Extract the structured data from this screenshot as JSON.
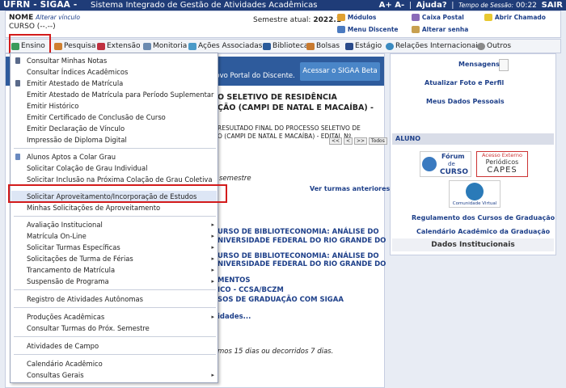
{
  "topbar": {
    "brand": "UFRN - SIGAA -",
    "subtitle": "Sistema Integrado de Gestão de Atividades Acadêmicas",
    "font_controls": "A+ A-",
    "help": "Ajuda?",
    "session_label": "Tempo de Sessão:",
    "session_time": "00:22",
    "logout": "SAIR"
  },
  "infobar": {
    "name_label": "NOME",
    "name_link": "Alterar vínculo",
    "course": "CURSO (--.--)",
    "semester_label": "Semestre atual:",
    "semester_value": "2022.1",
    "modulos": "Módulos",
    "caixa_postal": "Caixa Postal",
    "abrir_chamado": "Abrir Chamado",
    "menu_discente": "Menu Discente",
    "alterar_senha": "Alterar senha"
  },
  "menubar": {
    "items": [
      "Ensino",
      "Pesquisa",
      "Extensão",
      "Monitoria",
      "Ações Associadas",
      "Biblioteca",
      "Bolsas",
      "Estágio",
      "Relações Internacionais",
      "Outros"
    ]
  },
  "dropdown": {
    "group1": [
      "Consultar Minhas Notas",
      "Consultar Índices Acadêmicos",
      "Emitir Atestado de Matrícula",
      "Emitir Atestado de Matrícula para Período Suplementar",
      "Emitir Histórico",
      "Emitir Certificado de Conclusão de Curso",
      "Emitir Declaração de Vínculo",
      "Impressão de Diploma Digital"
    ],
    "group2": [
      "Alunos Aptos a Colar Grau",
      "Solicitar Colação de Grau Individual",
      "Solicitar Inclusão na Próxima Colação de Grau Coletiva",
      "Solicitar Aproveitamento/Incorporação de Estudos",
      "Minhas Solicitações de Aproveitamento"
    ],
    "group3": [
      "Avaliação Institucional",
      "Matrícula On-Line",
      "Solicitar Turmas Específicas",
      "Solicitações de Turma de Férias",
      "Trancamento de Matrícula",
      "Suspensão de Programa"
    ],
    "group4": [
      "Registro de Atividades Autônomas"
    ],
    "group5": [
      "Produções Acadêmicas",
      "Consultar Turmas do Próx. Semestre"
    ],
    "group6": [
      "Atividades de Campo"
    ],
    "group7": [
      "Calendário Acadêmico",
      "Consultas Gerais"
    ]
  },
  "main": {
    "portal_text": "novo Portal do Discente.",
    "portal_button": "Acessar o SIGAA Beta",
    "news_title_1": "O SELETIVO DE RESIDÊNCIA",
    "news_title_2": "ÇÃO (CAMPI DE NATAL E MACAÍBA) -",
    "news_body_1": "RESULTADO FINAL DO  PROCESSO SELETIVO DE",
    "news_body_2": "O (CAMPI DE NATAL E MACAÍBA) - EDITAL Nº",
    "pager": [
      "<<",
      "<",
      ">>",
      "Todos"
    ],
    "semestre_text": "semestre",
    "ver_turmas": "Ver turmas anteriores",
    "curso_1a": "URSO DE BIBLIOTECONOMIA: ANÁLISE DO",
    "curso_1b": "NIVERSIDADE FEDERAL DO RIO GRANDE DO",
    "curso_2a": "URSO DE BIBLIOTECONOMIA: ANÁLISE DO",
    "curso_2b": "NIVERSIDADE FEDERAL DO RIO GRANDE DO",
    "mentos": "MENTOS",
    "ccsa": "ICO - CCSA/BCZM",
    "sos": "SOS DE GRADUAÇÃO COM SIGAA",
    "idades": "idades...",
    "dias": "mos 15 dias ou decorridos 7 dias."
  },
  "right": {
    "mensagens": "Mensagens",
    "atualizar_foto": "Atualizar Foto e Perfil",
    "meus_dados": "Meus Dados Pessoais",
    "aluno_header": "ALUNO",
    "forum_1": "Fórum",
    "forum_2": "de",
    "forum_3": "CURSO",
    "capes_1": "Acesso Externo",
    "capes_2": "Periódicos",
    "capes_3": "CAPES",
    "comunidade": "Comunidade Virtual",
    "regulamento": "Regulamento dos Cursos de Graduação",
    "calendario": "Calendário Acadêmico da Graduação",
    "dados_institucionais": "Dados Institucionais"
  },
  "colors": {
    "topbar": "#1f3c78",
    "highlight_box": "#d31b1b",
    "link_blue": "#1d3f89",
    "button_blue": "#4a86c8"
  }
}
